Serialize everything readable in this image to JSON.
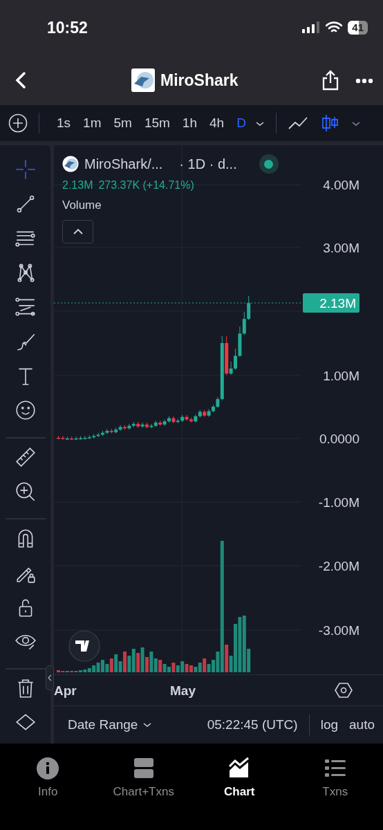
{
  "status_bar": {
    "time": "10:52",
    "battery": "41"
  },
  "header": {
    "title": "MiroShark"
  },
  "toolbar": {
    "intervals": [
      {
        "label": "1s",
        "selected": false
      },
      {
        "label": "1m",
        "selected": false
      },
      {
        "label": "5m",
        "selected": false
      },
      {
        "label": "15m",
        "selected": false
      },
      {
        "label": "1h",
        "selected": false
      },
      {
        "label": "4h",
        "selected": false
      },
      {
        "label": "D",
        "selected": true
      }
    ],
    "chart_types": [
      {
        "selected": false
      },
      {
        "selected": true
      }
    ]
  },
  "tool_groups": [
    [
      {
        "selected": true
      },
      {
        "selected": false
      },
      {
        "selected": false
      },
      {
        "selected": false
      },
      {
        "selected": false
      },
      {
        "selected": false
      },
      {
        "selected": false
      },
      {
        "selected": false
      }
    ],
    [
      {
        "selected": false
      },
      {
        "selected": false
      }
    ],
    [
      {
        "selected": false
      },
      {
        "selected": false
      },
      {
        "selected": false
      },
      {
        "selected": false
      }
    ],
    [
      {
        "selected": false
      },
      {
        "selected": false
      }
    ]
  ],
  "legend": {
    "symbol": "MiroShark/...",
    "interval": "· 1D · d...",
    "live": true,
    "price": "2.13M",
    "change": "273.37K (+14.71%)",
    "indicator": "Volume"
  },
  "price_axis_labels": [
    "4.00M",
    "3.00M",
    "1.00M",
    "0.0000",
    "-1.00M",
    "-2.00M",
    "-3.00M"
  ],
  "last_price": "2.13M",
  "time_axis_labels": [
    "Apr",
    "May"
  ],
  "footer": {
    "date_range": "Date Range",
    "clock": "05:22:45 (UTC)",
    "log": "log",
    "auto": "auto"
  },
  "tabs": [
    {
      "label": "Info",
      "selected": false
    },
    {
      "label": "Chart+Txns",
      "selected": false
    },
    {
      "label": "Chart",
      "selected": true
    },
    {
      "label": "Txns",
      "selected": false
    }
  ]
}
